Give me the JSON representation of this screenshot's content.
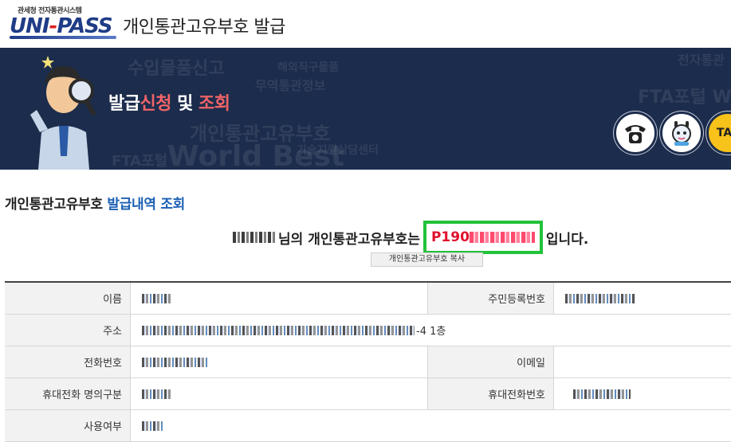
{
  "header": {
    "org_label": "관세청 전자통관시스템",
    "logo_text_uni": "UNI",
    "logo_text_dash": "-",
    "logo_text_pass": "PASS",
    "app_title": "개인통관고유부호 발급"
  },
  "banner": {
    "title_part1": "발급",
    "title_part2": "신청",
    "title_part3": " 및 ",
    "title_part4": "조회",
    "bg_words": [
      "수입물품신고",
      "해외직구물품",
      "무역통관정보",
      "개인통관고유부호",
      "FTA포털",
      "World Best",
      "기술지원상담센터",
      "전자통관",
      "FTA포털 World"
    ],
    "phone_icon": "phone-icon",
    "chatbot_icon": "chatbot-icon",
    "talk_label": "TAL"
  },
  "section": {
    "title_black": "개인통관고유부호",
    "title_blue": "발급내역 조회"
  },
  "result": {
    "suffix_name": "님의 개인통관고유부호는",
    "code_prefix": "P190",
    "suffix_end": "입니다.",
    "copy_button": "개인통관고유부호 복사"
  },
  "table": {
    "name_label": "이름",
    "rrn_label": "주민등록번호",
    "address_label": "주소",
    "address_tail": "-4 1층",
    "phone_label": "전화번호",
    "email_label": "이메일",
    "mobile_owner_label": "휴대전화 명의구분",
    "mobile_label": "휴대전화번호",
    "usage_label": "사용여부"
  },
  "colors": {
    "banner_bg": "#1c2c4c",
    "highlight_red": "#f06468",
    "code_red": "#e0102c",
    "box_green": "#22c23a",
    "link_blue": "#1a5fb4"
  }
}
